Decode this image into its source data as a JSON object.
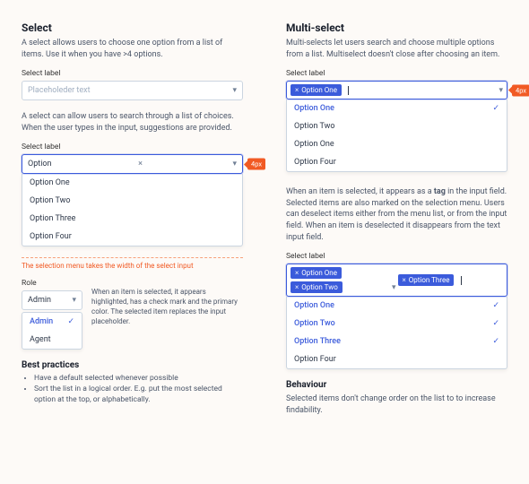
{
  "left": {
    "title": "Select",
    "intro": "A select allows users to choose one option from a list of items. Use it when you have >4 options.",
    "placeholder_example": {
      "label": "Select label",
      "placeholder": "Placeholeder text"
    },
    "search_intro": "A select can allow users to search through a list of choices. When the user types in the input, suggestions are provided.",
    "search_example": {
      "label": "Select label",
      "value": "Option",
      "annotation": "4px",
      "options": [
        "Option One",
        "Option Two",
        "Option Three",
        "Option Four"
      ]
    },
    "width_caption": "The selection menu takes the width of the select input",
    "role_example": {
      "label": "Role",
      "value": "Admin",
      "options": [
        "Admin",
        "Agent"
      ],
      "sidecopy": "When an item is selected, it appears highlighted, has a check mark and the primary color. The selected item replaces the input placeholder."
    },
    "best_practices": {
      "heading": "Best practices",
      "items": [
        "Have a default selected whenever possible",
        "Sort the list in a logical order. E.g. put the most selected option at the top, or alphabetically."
      ]
    }
  },
  "right": {
    "title": "Multi-select",
    "intro": "Multi-selects let users search and choose multiple options from a list. Multiselect doesn't close after choosing an item.",
    "one_selected": {
      "label": "Select label",
      "tag": "Option One",
      "annotation": "4px",
      "options": [
        {
          "label": "Option One",
          "selected": true
        },
        {
          "label": "Option Two",
          "selected": false
        },
        {
          "label": "Option One",
          "selected": false
        },
        {
          "label": "Option Four",
          "selected": false
        }
      ]
    },
    "tag_desc_pre": "When an item is selected, it appears as a ",
    "tag_desc_bold": "tag",
    "tag_desc_post": " in the input field. Selected items are also marked on the selection menu. Users can deselect items either from the menu list, or from the input field. When an item is deselected it disappears from the text input field.",
    "three_selected": {
      "label": "Select label",
      "tags": [
        "Option One",
        "Option Two",
        "Option Three"
      ],
      "options": [
        {
          "label": "Option One",
          "selected": true
        },
        {
          "label": "Option Two",
          "selected": true
        },
        {
          "label": "Option Three",
          "selected": true
        },
        {
          "label": "Option Four",
          "selected": false
        }
      ]
    },
    "behaviour": {
      "heading": "Behaviour",
      "text": "Selected items don't change order on the list to to increase findability."
    }
  }
}
